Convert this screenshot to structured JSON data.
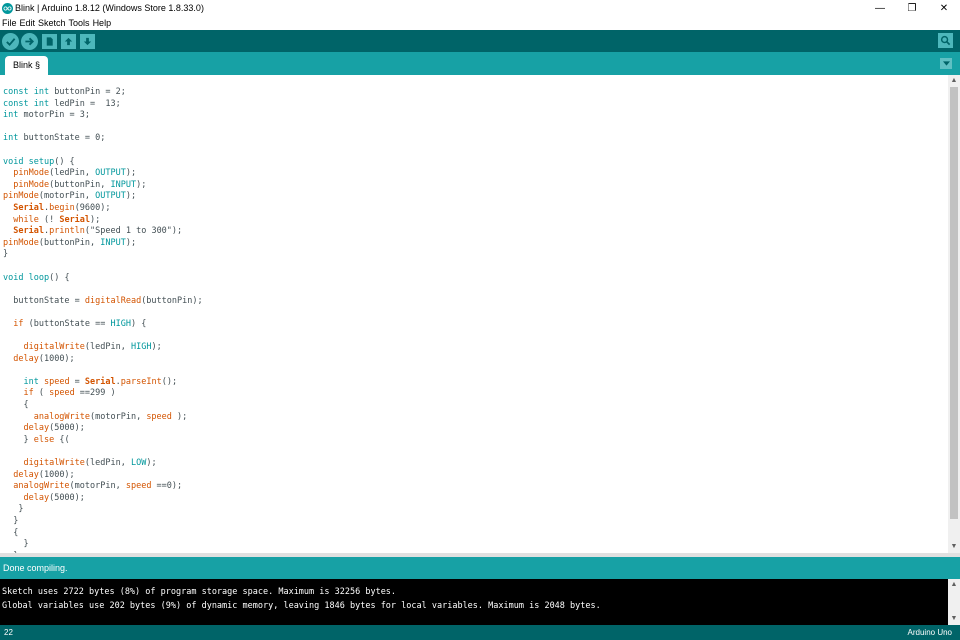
{
  "window": {
    "title": "Blink | Arduino 1.8.12 (Windows Store 1.8.33.0)",
    "controls": {
      "minimize": "—",
      "restore": "❐",
      "close": "✕"
    }
  },
  "menu": [
    "File",
    "Edit",
    "Sketch",
    "Tools",
    "Help"
  ],
  "toolbar": {
    "buttons": [
      "verify-icon",
      "upload-icon",
      "new-icon",
      "open-icon",
      "save-icon"
    ],
    "right_button": "serial-monitor-icon"
  },
  "tabs": [
    {
      "label": "Blink §"
    }
  ],
  "editor": {
    "lines": [
      [
        {
          "t": "const",
          "c": "kw"
        },
        {
          "t": " "
        },
        {
          "t": "int",
          "c": "kw"
        },
        {
          "t": " buttonPin = 2;"
        }
      ],
      [
        {
          "t": "const",
          "c": "kw"
        },
        {
          "t": " "
        },
        {
          "t": "int",
          "c": "kw"
        },
        {
          "t": " ledPin =  13;"
        }
      ],
      [
        {
          "t": "int",
          "c": "kw"
        },
        {
          "t": " motorPin = 3;"
        }
      ],
      [],
      [
        {
          "t": "int",
          "c": "kw"
        },
        {
          "t": " buttonState = 0;"
        }
      ],
      [],
      [
        {
          "t": "void",
          "c": "kw"
        },
        {
          "t": " "
        },
        {
          "t": "setup",
          "c": "kw"
        },
        {
          "t": "() {"
        }
      ],
      [
        {
          "t": "  "
        },
        {
          "t": "pinMode",
          "c": "fn"
        },
        {
          "t": "(ledPin, "
        },
        {
          "t": "OUTPUT",
          "c": "kw"
        },
        {
          "t": ");"
        }
      ],
      [
        {
          "t": "  "
        },
        {
          "t": "pinMode",
          "c": "fn"
        },
        {
          "t": "(buttonPin, "
        },
        {
          "t": "INPUT",
          "c": "kw"
        },
        {
          "t": ");"
        }
      ],
      [
        {
          "t": "pinMode",
          "c": "fn"
        },
        {
          "t": "(motorPin, "
        },
        {
          "t": "OUTPUT",
          "c": "kw"
        },
        {
          "t": ");"
        }
      ],
      [
        {
          "t": "  "
        },
        {
          "t": "Serial",
          "c": "cls"
        },
        {
          "t": "."
        },
        {
          "t": "begin",
          "c": "fn"
        },
        {
          "t": "(9600);"
        }
      ],
      [
        {
          "t": "  "
        },
        {
          "t": "while",
          "c": "fn"
        },
        {
          "t": " (! "
        },
        {
          "t": "Serial",
          "c": "cls"
        },
        {
          "t": ");"
        }
      ],
      [
        {
          "t": "  "
        },
        {
          "t": "Serial",
          "c": "cls"
        },
        {
          "t": "."
        },
        {
          "t": "println",
          "c": "fn"
        },
        {
          "t": "(\"Speed 1 to 300\");"
        }
      ],
      [
        {
          "t": "pinMode",
          "c": "fn"
        },
        {
          "t": "(buttonPin, "
        },
        {
          "t": "INPUT",
          "c": "kw"
        },
        {
          "t": ");"
        }
      ],
      [
        {
          "t": "}"
        }
      ],
      [],
      [
        {
          "t": "void",
          "c": "kw"
        },
        {
          "t": " "
        },
        {
          "t": "loop",
          "c": "kw"
        },
        {
          "t": "() {"
        }
      ],
      [],
      [
        {
          "t": "  buttonState = "
        },
        {
          "t": "digitalRead",
          "c": "fn"
        },
        {
          "t": "(buttonPin);"
        }
      ],
      [],
      [
        {
          "t": "  "
        },
        {
          "t": "if",
          "c": "fn"
        },
        {
          "t": " (buttonState == "
        },
        {
          "t": "HIGH",
          "c": "kw"
        },
        {
          "t": ") {"
        }
      ],
      [],
      [
        {
          "t": "    "
        },
        {
          "t": "digitalWrite",
          "c": "fn"
        },
        {
          "t": "(ledPin, "
        },
        {
          "t": "HIGH",
          "c": "kw"
        },
        {
          "t": ");"
        }
      ],
      [
        {
          "t": "  "
        },
        {
          "t": "delay",
          "c": "fn"
        },
        {
          "t": "(1000);"
        }
      ],
      [],
      [
        {
          "t": "    "
        },
        {
          "t": "int",
          "c": "kw"
        },
        {
          "t": " "
        },
        {
          "t": "speed",
          "c": "fn"
        },
        {
          "t": " = "
        },
        {
          "t": "Serial",
          "c": "cls"
        },
        {
          "t": "."
        },
        {
          "t": "parseInt",
          "c": "fn"
        },
        {
          "t": "();"
        }
      ],
      [
        {
          "t": "    "
        },
        {
          "t": "if",
          "c": "fn"
        },
        {
          "t": " ( "
        },
        {
          "t": "speed",
          "c": "fn"
        },
        {
          "t": " ==299 )"
        }
      ],
      [
        {
          "t": "    {"
        }
      ],
      [
        {
          "t": "      "
        },
        {
          "t": "analogWrite",
          "c": "fn"
        },
        {
          "t": "(motorPin, "
        },
        {
          "t": "speed",
          "c": "fn"
        },
        {
          "t": " );"
        }
      ],
      [
        {
          "t": "    "
        },
        {
          "t": "delay",
          "c": "fn"
        },
        {
          "t": "(5000);"
        }
      ],
      [
        {
          "t": "    } "
        },
        {
          "t": "else",
          "c": "fn"
        },
        {
          "t": " {("
        }
      ],
      [],
      [
        {
          "t": "    "
        },
        {
          "t": "digitalWrite",
          "c": "fn"
        },
        {
          "t": "(ledPin, "
        },
        {
          "t": "LOW",
          "c": "kw"
        },
        {
          "t": ");"
        }
      ],
      [
        {
          "t": "  "
        },
        {
          "t": "delay",
          "c": "fn"
        },
        {
          "t": "(1000);"
        }
      ],
      [
        {
          "t": "  "
        },
        {
          "t": "analogWrite",
          "c": "fn"
        },
        {
          "t": "(motorPin, "
        },
        {
          "t": "speed",
          "c": "fn"
        },
        {
          "t": " ==0);"
        }
      ],
      [
        {
          "t": "    "
        },
        {
          "t": "delay",
          "c": "fn"
        },
        {
          "t": "(5000);"
        }
      ],
      [
        {
          "t": "   }"
        }
      ],
      [
        {
          "t": "  }"
        }
      ],
      [
        {
          "t": "  {"
        }
      ],
      [
        {
          "t": "    }"
        }
      ],
      [
        {
          "t": "  }"
        }
      ]
    ]
  },
  "status": {
    "message": "Done compiling."
  },
  "console": {
    "lines": [
      "Sketch uses 2722 bytes (8%) of program storage space. Maximum is 32256 bytes.",
      "Global variables use 202 bytes (9%) of dynamic memory, leaving 1846 bytes for local variables. Maximum is 2048 bytes."
    ]
  },
  "footer": {
    "line_number": "22",
    "board": "Arduino Uno"
  },
  "colors": {
    "teal_dark": "#006468",
    "teal": "#17a1a5",
    "keyword": "#00979c",
    "function": "#d35400",
    "text": "#434f54"
  }
}
